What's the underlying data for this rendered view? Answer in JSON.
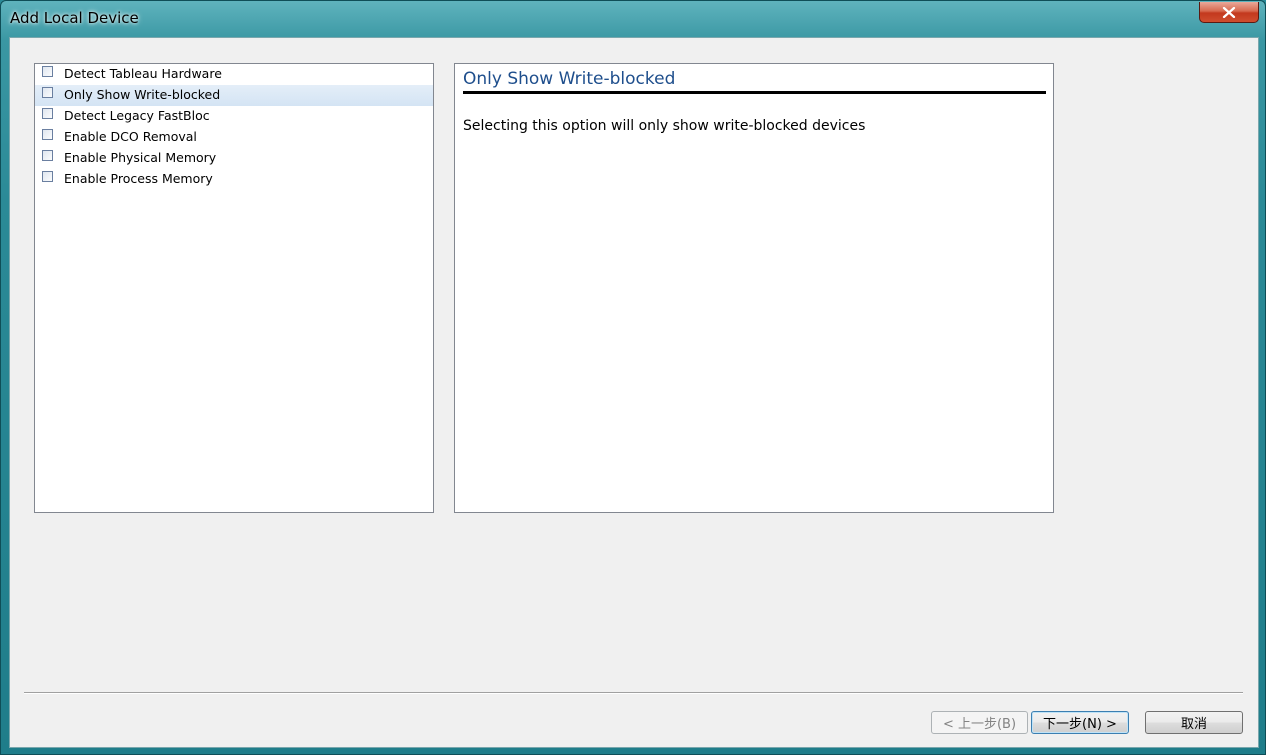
{
  "window": {
    "title": "Add Local Device"
  },
  "options": [
    {
      "label": "Detect Tableau Hardware",
      "checked": false,
      "selected": false
    },
    {
      "label": "Only Show Write-blocked",
      "checked": false,
      "selected": true
    },
    {
      "label": "Detect Legacy FastBloc",
      "checked": false,
      "selected": false
    },
    {
      "label": "Enable DCO Removal",
      "checked": false,
      "selected": false
    },
    {
      "label": "Enable Physical Memory",
      "checked": false,
      "selected": false
    },
    {
      "label": "Enable Process Memory",
      "checked": false,
      "selected": false
    }
  ],
  "description": {
    "title": "Only Show Write-blocked",
    "text": "Selecting this option will only show write-blocked devices"
  },
  "buttons": {
    "back": "< 上一步(B)",
    "next": "下一步(N) >",
    "cancel": "取消"
  },
  "colors": {
    "accent_title": "#1e4e8c",
    "frame": "#2b8a97",
    "close_button": "#c3391e"
  },
  "icons": {
    "close": "close-icon"
  }
}
